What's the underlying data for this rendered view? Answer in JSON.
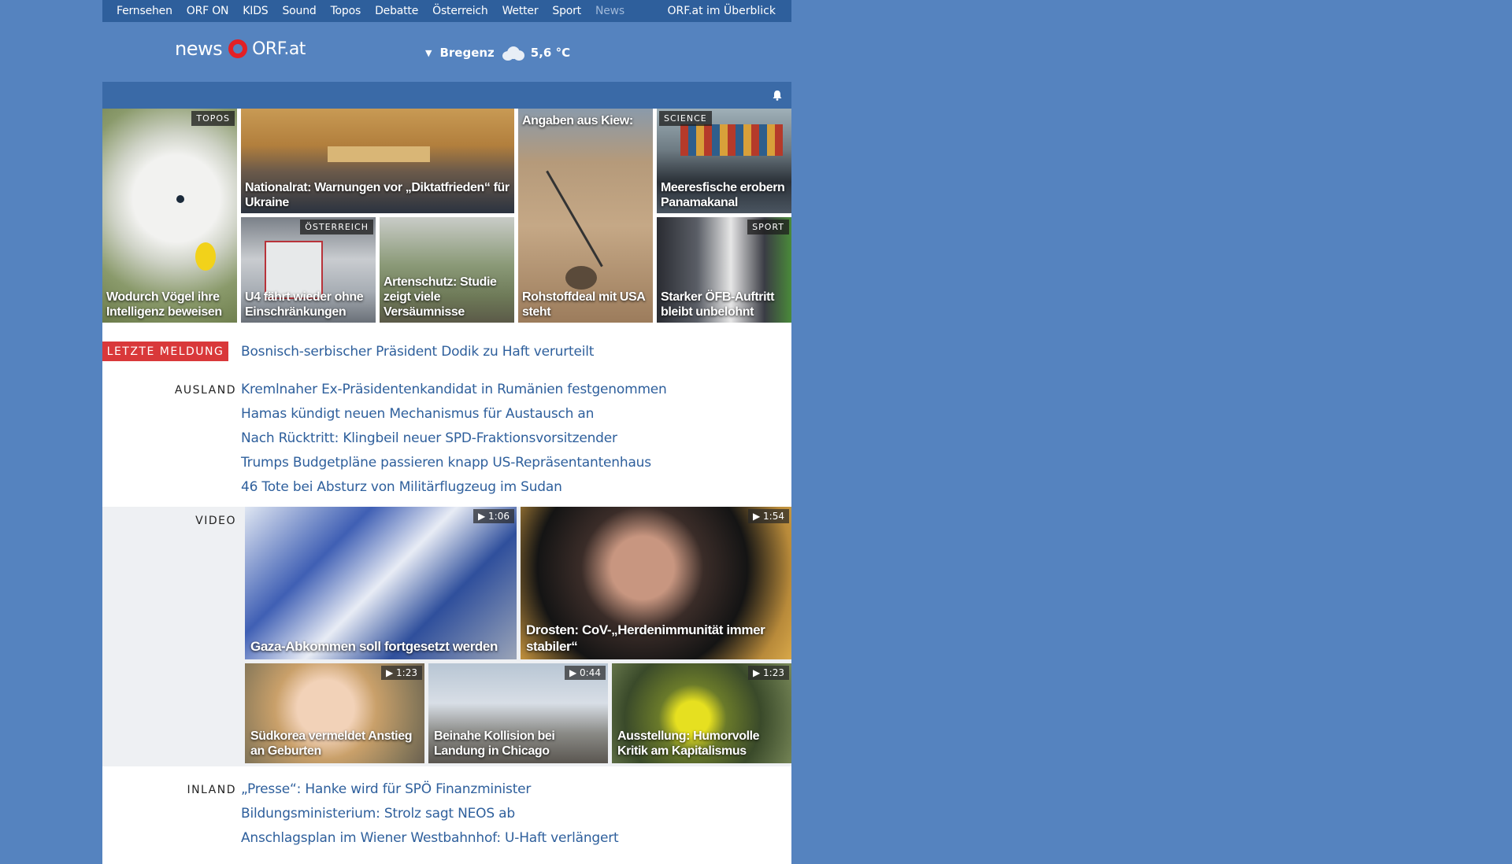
{
  "nav": {
    "items": [
      "Fernsehen",
      "ORF ON",
      "KIDS",
      "Sound",
      "Topos",
      "Debatte",
      "Österreich",
      "Wetter",
      "Sport",
      "News"
    ],
    "overview": "ORF.at im Überblick"
  },
  "logo": {
    "news": "news",
    "orf": "ORF.at"
  },
  "weather": {
    "city": "Bregenz",
    "temp": "5,6 °C",
    "icon": "cloud-icon"
  },
  "mosaic": [
    {
      "caption": "Wodurch Vögel ihre Intelligenz beweisen",
      "tag": "TOPOS"
    },
    {
      "caption": "Nationalrat: Warnungen vor „Diktatfrieden“ für Ukraine",
      "tag": ""
    },
    {
      "caption": "Angaben aus Kiew: Rohstoffdeal mit USA steht",
      "tag": "",
      "caption_top": "Angaben aus Kiew:",
      "caption_bottom": "Rohstoffdeal mit USA steht"
    },
    {
      "caption": "Meeresfische erobern Panamakanal",
      "tag": "SCIENCE"
    },
    {
      "caption": "U4 fährt wieder ohne Einschränkungen",
      "tag": "ÖSTERREICH"
    },
    {
      "caption": "Artenschutz: Studie zeigt viele Versäumnisse",
      "tag": ""
    },
    {
      "caption": "Starker ÖFB-Auftritt bleibt unbelohnt",
      "tag": "SPORT"
    }
  ],
  "breaking": {
    "label": "LETZTE MELDUNG",
    "headline": "Bosnisch-serbischer Präsident Dodik zu Haft verurteilt"
  },
  "ausland": {
    "label": "AUSLAND",
    "links": [
      "Kremlnaher Ex-Präsidentenkandidat in Rumänien festgenommen",
      "Hamas kündigt neuen Mechanismus für Austausch an",
      "Nach Rücktritt: Klingbeil neuer SPD-Fraktionsvorsitzender",
      "Trumps Budgetpläne passieren knapp US-Repräsentantenhaus",
      "46 Tote bei Absturz von Militärflugzeug im Sudan"
    ]
  },
  "video": {
    "label": "VIDEO",
    "items": [
      {
        "caption": "Gaza-Abkommen soll fortgesetzt werden",
        "duration": "1:06"
      },
      {
        "caption": "Drosten: CoV-„Herdenimmunität immer stabiler“",
        "duration": "1:54"
      },
      {
        "caption": "Südkorea vermeldet Anstieg an Geburten",
        "duration": "1:23"
      },
      {
        "caption": "Beinahe Kollision bei Landung in Chicago",
        "duration": "0:44"
      },
      {
        "caption": "Ausstellung: Humorvolle Kritik am Kapitalismus",
        "duration": "1:23"
      }
    ]
  },
  "inland": {
    "label": "INLAND",
    "links": [
      "„Presse“: Hanke wird für SPÖ Finanzminister",
      "Bildungsministerium: Strolz sagt NEOS ab",
      "Anschlagsplan im Wiener Westbahnhof: U-Haft verlängert"
    ]
  },
  "colors": {
    "background": "#5583bf",
    "nav": "#2e5f9c",
    "link": "#2e5f9c",
    "breaking": "#d9383a"
  }
}
